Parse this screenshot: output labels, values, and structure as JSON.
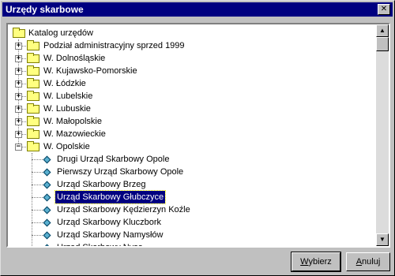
{
  "window": {
    "title": "Urzędy skarbowe",
    "close_label": "✕"
  },
  "tree": {
    "items": [
      {
        "label": "Katalog urzędów",
        "type": "root"
      },
      {
        "label": "Podział administracyjny sprzed 1999",
        "type": "folder",
        "expander": "+"
      },
      {
        "label": "W. Dolnośląskie",
        "type": "folder",
        "expander": "+"
      },
      {
        "label": "W. Kujawsko-Pomorskie",
        "type": "folder",
        "expander": "+"
      },
      {
        "label": "W. Łódzkie",
        "type": "folder",
        "expander": "+"
      },
      {
        "label": "W. Lubelskie",
        "type": "folder",
        "expander": "+"
      },
      {
        "label": "W. Lubuskie",
        "type": "folder",
        "expander": "+"
      },
      {
        "label": "W. Małopolskie",
        "type": "folder",
        "expander": "+"
      },
      {
        "label": "W. Mazowieckie",
        "type": "folder",
        "expander": "+"
      },
      {
        "label": "W. Opolskie",
        "type": "folder",
        "expander": "−"
      },
      {
        "label": "Drugi Urząd Skarbowy Opole",
        "type": "leaf"
      },
      {
        "label": "Pierwszy Urząd Skarbowy Opole",
        "type": "leaf"
      },
      {
        "label": "Urząd Skarbowy Brzeg",
        "type": "leaf"
      },
      {
        "label": "Urząd Skarbowy Głubczyce",
        "type": "leaf",
        "selected": true
      },
      {
        "label": "Urząd Skarbowy Kędzierzyn Koźle",
        "type": "leaf"
      },
      {
        "label": "Urząd Skarbowy Kluczbork",
        "type": "leaf"
      },
      {
        "label": "Urząd Skarbowy Namysłów",
        "type": "leaf"
      },
      {
        "label": "Urząd Skarbowy Nysa",
        "type": "leaf"
      }
    ]
  },
  "buttons": {
    "select": {
      "ul": "W",
      "rest": "ybierz"
    },
    "cancel": {
      "ul": "A",
      "rest": "nuluj"
    }
  },
  "icons": {
    "up": "▲",
    "down": "▼"
  }
}
